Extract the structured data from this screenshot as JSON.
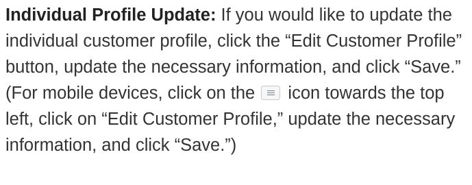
{
  "paragraph": {
    "heading": "Individual Profile Update:",
    "text_part1": " If you would like to update the individual customer profile, click the “Edit Customer Profile” button, update the necessary information, and click “Save.” (For mobile devices, click on the ",
    "icon_name": "menu-icon",
    "text_part2": " icon towards the top left, click on “Edit Customer Profile,” update the necessary information, and click “Save.”)"
  }
}
